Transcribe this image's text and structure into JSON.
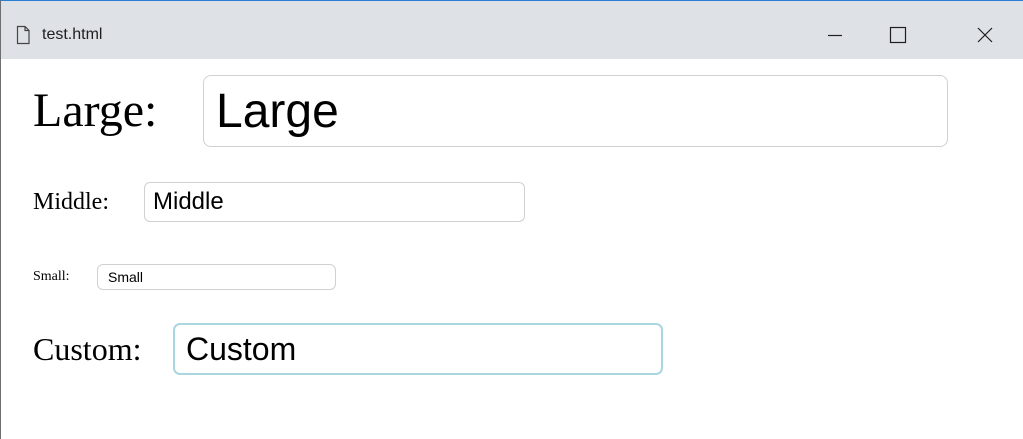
{
  "window": {
    "title": "test.html",
    "icons": {
      "document": "document-icon",
      "minimize": "minimize-icon",
      "maximize": "maximize-icon",
      "close": "close-icon"
    },
    "colors": {
      "titlebar": "#dee1e6",
      "focus_border": "#a9d6df"
    }
  },
  "form": {
    "large": {
      "label": "Large:",
      "value": "Large"
    },
    "middle": {
      "label": "Middle:",
      "value": "Middle"
    },
    "small": {
      "label": "Small:",
      "value": "Small"
    },
    "custom": {
      "label": "Custom:",
      "value": "Custom",
      "focused": true
    }
  }
}
